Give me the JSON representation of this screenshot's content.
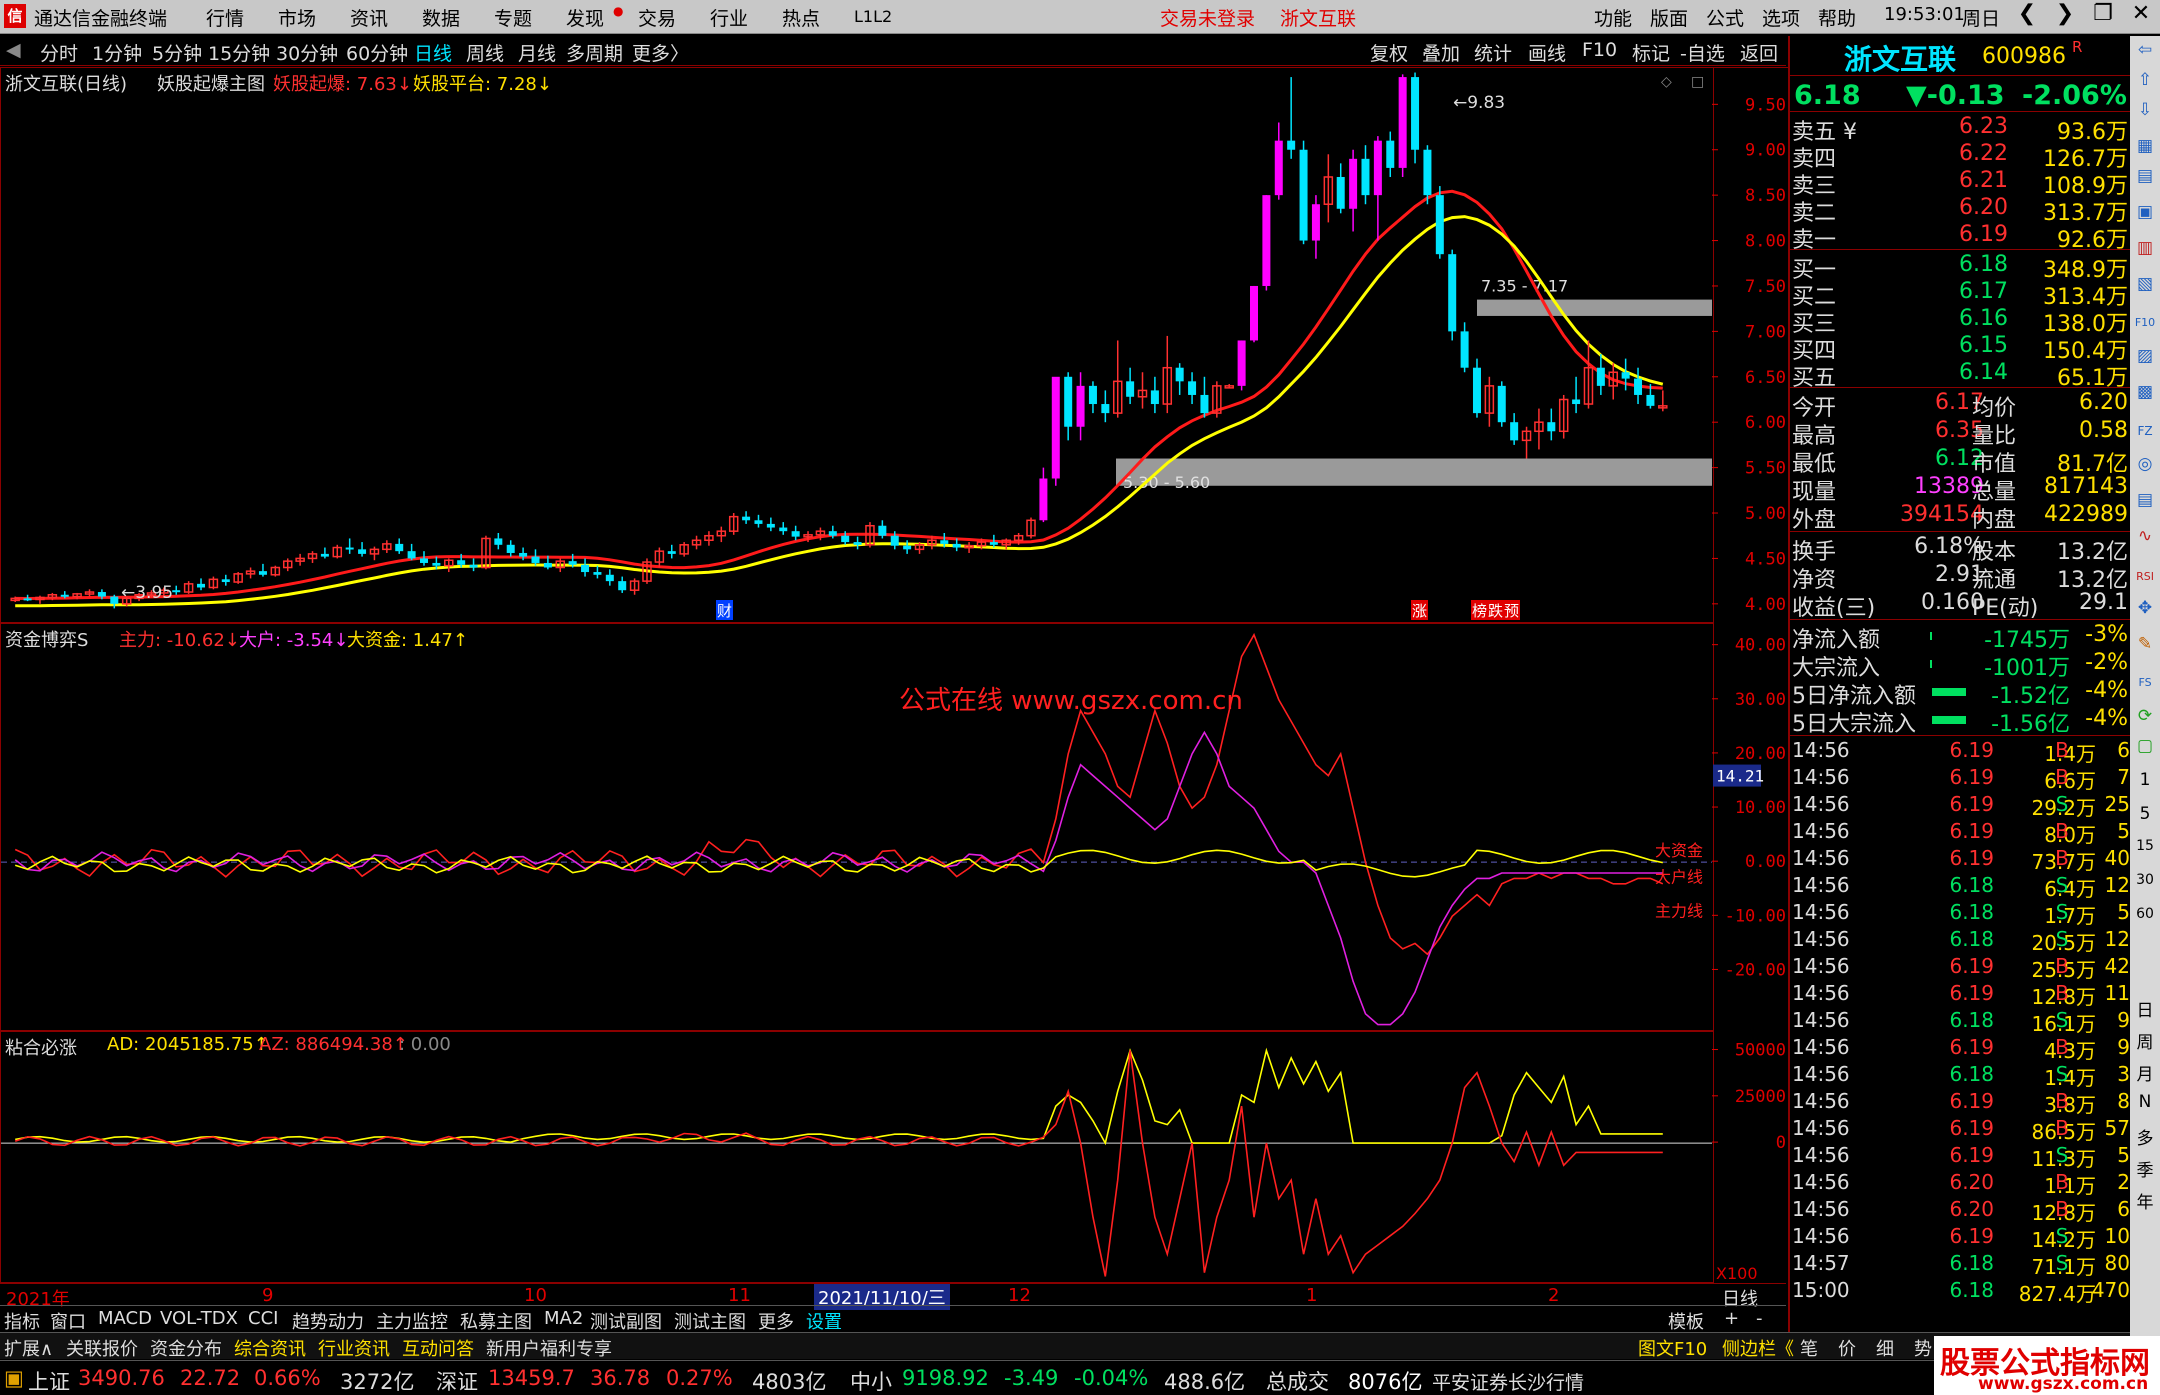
{
  "app": {
    "title": "通达信金融终端",
    "menus": [
      "行情",
      "市场",
      "资讯",
      "数据",
      "专题",
      "发现",
      "交易",
      "行业",
      "热点",
      "L1L2"
    ],
    "center_left": "交易未登录",
    "center_right": "浙文互联",
    "right_menus": [
      "功能",
      "版面",
      "公式",
      "选项",
      "帮助"
    ],
    "clock": "19:53:01",
    "weekday": "周日",
    "wctrl": [
      "❮",
      "❯",
      "❐",
      "✕"
    ]
  },
  "periods": [
    "分时",
    "1分钟",
    "5分钟",
    "15分钟",
    "30分钟",
    "60分钟",
    "日线",
    "周线",
    "月线",
    "多周期",
    "更多〉"
  ],
  "chart_tools": [
    "复权",
    "叠加",
    "统计",
    "画线",
    "F10",
    "标记",
    "-自选",
    "返回"
  ],
  "main_chart": {
    "header": {
      "name": "浙文互联(日线)",
      "formula": "妖股起爆主图",
      "i1": "妖股起爆: 7.63↓",
      "i2": "妖股平台: 7.28↓"
    },
    "yticks": [
      "9.50",
      "9.00",
      "8.50",
      "8.00",
      "7.50",
      "7.00",
      "6.50",
      "6.00",
      "5.50",
      "5.00",
      "4.50",
      "4.00"
    ],
    "ymin": 3.8,
    "ymax": 9.9,
    "annotations": {
      "high": "9.83",
      "low": "3.95",
      "band1": "5.30 - 5.60",
      "band2": "7.35 - 7.17"
    },
    "bands": [
      [
        5.3,
        5.6
      ],
      [
        7.17,
        7.35
      ]
    ],
    "markers": [
      "财",
      "涨",
      "榜",
      "跌",
      "预"
    ],
    "candles": [
      [
        4.05,
        4.08,
        4.02,
        4.06
      ],
      [
        4.06,
        4.1,
        4.03,
        4.05
      ],
      [
        4.05,
        4.09,
        4.0,
        4.07
      ],
      [
        4.07,
        4.12,
        4.04,
        4.1
      ],
      [
        4.1,
        4.14,
        4.06,
        4.08
      ],
      [
        4.08,
        4.12,
        4.05,
        4.11
      ],
      [
        4.11,
        4.16,
        4.08,
        4.13
      ],
      [
        4.13,
        4.16,
        4.05,
        4.08
      ],
      [
        4.08,
        4.1,
        3.95,
        4.0
      ],
      [
        4.0,
        4.08,
        3.97,
        4.06
      ],
      [
        4.06,
        4.12,
        4.03,
        4.1
      ],
      [
        4.1,
        4.15,
        4.07,
        4.12
      ],
      [
        4.12,
        4.18,
        4.09,
        4.15
      ],
      [
        4.15,
        4.2,
        4.1,
        4.13
      ],
      [
        4.13,
        4.25,
        4.11,
        4.22
      ],
      [
        4.22,
        4.28,
        4.15,
        4.18
      ],
      [
        4.18,
        4.3,
        4.16,
        4.27
      ],
      [
        4.27,
        4.32,
        4.2,
        4.24
      ],
      [
        4.24,
        4.35,
        4.22,
        4.33
      ],
      [
        4.33,
        4.4,
        4.28,
        4.36
      ],
      [
        4.36,
        4.44,
        4.3,
        4.32
      ],
      [
        4.32,
        4.42,
        4.3,
        4.4
      ],
      [
        4.4,
        4.5,
        4.36,
        4.47
      ],
      [
        4.47,
        4.55,
        4.42,
        4.5
      ],
      [
        4.5,
        4.58,
        4.45,
        4.55
      ],
      [
        4.55,
        4.62,
        4.5,
        4.52
      ],
      [
        4.52,
        4.65,
        4.5,
        4.62
      ],
      [
        4.62,
        4.72,
        4.55,
        4.6
      ],
      [
        4.6,
        4.68,
        4.52,
        4.55
      ],
      [
        4.55,
        4.63,
        4.48,
        4.6
      ],
      [
        4.6,
        4.7,
        4.56,
        4.66
      ],
      [
        4.66,
        4.72,
        4.55,
        4.58
      ],
      [
        4.58,
        4.66,
        4.48,
        4.5
      ],
      [
        4.5,
        4.58,
        4.42,
        4.45
      ],
      [
        4.45,
        4.52,
        4.38,
        4.42
      ],
      [
        4.42,
        4.5,
        4.35,
        4.48
      ],
      [
        4.48,
        4.55,
        4.4,
        4.43
      ],
      [
        4.43,
        4.5,
        4.36,
        4.4
      ],
      [
        4.4,
        4.75,
        4.38,
        4.72
      ],
      [
        4.72,
        4.78,
        4.6,
        4.65
      ],
      [
        4.65,
        4.7,
        4.52,
        4.56
      ],
      [
        4.56,
        4.62,
        4.48,
        4.52
      ],
      [
        4.52,
        4.6,
        4.42,
        4.45
      ],
      [
        4.45,
        4.53,
        4.38,
        4.4
      ],
      [
        4.4,
        4.5,
        4.35,
        4.47
      ],
      [
        4.47,
        4.55,
        4.4,
        4.43
      ],
      [
        4.43,
        4.5,
        4.3,
        4.35
      ],
      [
        4.35,
        4.42,
        4.28,
        4.32
      ],
      [
        4.32,
        4.38,
        4.2,
        4.25
      ],
      [
        4.25,
        4.3,
        4.12,
        4.15
      ],
      [
        4.15,
        4.28,
        4.1,
        4.25
      ],
      [
        4.25,
        4.5,
        4.22,
        4.46
      ],
      [
        4.46,
        4.62,
        4.4,
        4.58
      ],
      [
        4.58,
        4.65,
        4.5,
        4.55
      ],
      [
        4.55,
        4.68,
        4.52,
        4.65
      ],
      [
        4.65,
        4.75,
        4.6,
        4.7
      ],
      [
        4.7,
        4.8,
        4.64,
        4.75
      ],
      [
        4.75,
        4.85,
        4.68,
        4.8
      ],
      [
        4.8,
        5.0,
        4.76,
        4.96
      ],
      [
        4.96,
        5.02,
        4.88,
        4.92
      ],
      [
        4.92,
        4.98,
        4.84,
        4.88
      ],
      [
        4.88,
        4.95,
        4.8,
        4.84
      ],
      [
        4.84,
        4.9,
        4.76,
        4.8
      ],
      [
        4.8,
        4.86,
        4.7,
        4.74
      ],
      [
        4.74,
        4.8,
        4.68,
        4.76
      ],
      [
        4.76,
        4.84,
        4.7,
        4.8
      ],
      [
        4.8,
        4.86,
        4.72,
        4.75
      ],
      [
        4.75,
        4.8,
        4.65,
        4.68
      ],
      [
        4.68,
        4.74,
        4.6,
        4.65
      ],
      [
        4.65,
        4.9,
        4.62,
        4.86
      ],
      [
        4.86,
        4.92,
        4.72,
        4.75
      ],
      [
        4.75,
        4.8,
        4.6,
        4.64
      ],
      [
        4.64,
        4.7,
        4.55,
        4.6
      ],
      [
        4.6,
        4.68,
        4.55,
        4.65
      ],
      [
        4.65,
        4.75,
        4.6,
        4.7
      ],
      [
        4.7,
        4.78,
        4.62,
        4.66
      ],
      [
        4.66,
        4.72,
        4.58,
        4.62
      ],
      [
        4.62,
        4.68,
        4.56,
        4.64
      ],
      [
        4.64,
        4.72,
        4.6,
        4.68
      ],
      [
        4.68,
        4.76,
        4.62,
        4.65
      ],
      [
        4.65,
        4.72,
        4.6,
        4.7
      ],
      [
        4.7,
        4.78,
        4.65,
        4.75
      ],
      [
        4.75,
        4.95,
        4.72,
        4.92
      ],
      [
        4.92,
        5.5,
        4.9,
        5.38
      ],
      [
        5.38,
        6.4,
        5.3,
        6.5
      ],
      [
        6.5,
        6.55,
        5.8,
        5.95
      ],
      [
        5.95,
        6.55,
        5.8,
        6.4
      ],
      [
        6.4,
        6.45,
        6.1,
        6.2
      ],
      [
        6.2,
        6.35,
        6.0,
        6.1
      ],
      [
        6.1,
        6.9,
        6.05,
        6.45
      ],
      [
        6.45,
        6.6,
        6.2,
        6.28
      ],
      [
        6.28,
        6.55,
        6.15,
        6.35
      ],
      [
        6.35,
        6.5,
        6.1,
        6.2
      ],
      [
        6.2,
        6.95,
        6.1,
        6.6
      ],
      [
        6.6,
        6.65,
        6.3,
        6.45
      ],
      [
        6.45,
        6.55,
        6.2,
        6.3
      ],
      [
        6.3,
        6.5,
        6.05,
        6.1
      ],
      [
        6.1,
        6.45,
        6.05,
        6.4
      ],
      [
        6.4,
        6.42,
        6.38,
        6.4
      ],
      [
        6.4,
        6.9,
        6.35,
        6.9
      ],
      [
        6.9,
        7.5,
        6.88,
        7.5
      ],
      [
        7.5,
        8.5,
        7.45,
        8.5
      ],
      [
        8.5,
        9.3,
        8.45,
        9.1
      ],
      [
        9.1,
        9.8,
        8.9,
        9.0
      ],
      [
        9.0,
        9.1,
        7.96,
        8.0
      ],
      [
        8.0,
        8.5,
        7.8,
        8.4
      ],
      [
        8.4,
        8.95,
        8.2,
        8.7
      ],
      [
        8.7,
        8.85,
        8.3,
        8.35
      ],
      [
        8.35,
        9.0,
        8.1,
        8.9
      ],
      [
        8.9,
        9.05,
        8.4,
        8.5
      ],
      [
        8.5,
        9.15,
        8.0,
        9.1
      ],
      [
        9.1,
        9.2,
        8.7,
        8.8
      ],
      [
        8.8,
        9.83,
        8.7,
        9.8
      ],
      [
        9.8,
        9.85,
        8.85,
        9.0
      ],
      [
        9.0,
        9.05,
        8.4,
        8.5
      ],
      [
        8.5,
        8.6,
        7.8,
        7.85
      ],
      [
        7.85,
        7.9,
        6.9,
        7.0
      ],
      [
        7.0,
        7.1,
        6.55,
        6.6
      ],
      [
        6.6,
        6.7,
        6.05,
        6.1
      ],
      [
        6.1,
        6.5,
        5.95,
        6.4
      ],
      [
        6.4,
        6.45,
        5.95,
        6.0
      ],
      [
        6.0,
        6.1,
        5.75,
        5.8
      ],
      [
        5.8,
        5.95,
        5.6,
        5.9
      ],
      [
        5.9,
        6.15,
        5.7,
        6.0
      ],
      [
        6.0,
        6.15,
        5.8,
        5.9
      ],
      [
        5.9,
        6.3,
        5.82,
        6.25
      ],
      [
        6.25,
        6.5,
        6.1,
        6.2
      ],
      [
        6.2,
        6.9,
        6.15,
        6.6
      ],
      [
        6.6,
        6.75,
        6.3,
        6.4
      ],
      [
        6.4,
        6.65,
        6.25,
        6.55
      ],
      [
        6.55,
        6.7,
        6.35,
        6.48
      ],
      [
        6.48,
        6.6,
        6.2,
        6.3
      ],
      [
        6.3,
        6.42,
        6.15,
        6.18
      ],
      [
        6.18,
        6.35,
        6.12,
        6.18
      ]
    ]
  },
  "mid_chart": {
    "header": {
      "name": "资金博弈S",
      "a": "主力: -10.62↓",
      "b": "大户: -3.54↓",
      "c": "大资金: 1.47↑"
    },
    "watermark": "公式在线  www.gszx.com.cn",
    "yticks": [
      "40.00",
      "30.00",
      "20.00",
      "10.00",
      "0.00",
      "-10.00",
      "-20.00"
    ],
    "ymin": -31,
    "ymax": 44,
    "cursor_value": "14.21",
    "line_labels": [
      "大资金",
      "大户线",
      "主力线"
    ]
  },
  "low_chart": {
    "header": {
      "name": "粘合必涨",
      "a": "AD: 2045185.75↑",
      "b": "AZ: 886494.38↑",
      "c": ": 0.00"
    },
    "yticks": [
      "50000",
      "25000",
      "0"
    ],
    "ymin": -75000,
    "ymax": 60000,
    "scale_label": "X100"
  },
  "xaxis": [
    "2021年",
    "9",
    "10",
    "11",
    "12",
    "1",
    "2"
  ],
  "xaxis_sel": "2021/11/10/三",
  "xaxis_right": "日线",
  "quote": {
    "name": "浙文互联",
    "code": "600986",
    "flag": "R",
    "price": "6.18",
    "change": "▼-0.13",
    "pct": "-2.06%",
    "asks": [
      [
        "卖五 ¥",
        "6.23",
        "93.6万"
      ],
      [
        "卖四",
        "6.22",
        "126.7万"
      ],
      [
        "卖三",
        "6.21",
        "108.9万"
      ],
      [
        "卖二",
        "6.20",
        "313.7万"
      ],
      [
        "卖一",
        "6.19",
        "92.6万"
      ]
    ],
    "bids": [
      [
        "买一",
        "6.18",
        "348.9万"
      ],
      [
        "买二",
        "6.17",
        "313.4万"
      ],
      [
        "买三",
        "6.16",
        "138.0万"
      ],
      [
        "买四",
        "6.15",
        "150.4万"
      ],
      [
        "买五",
        "6.14",
        "65.1万"
      ]
    ],
    "stats": [
      [
        "今开",
        "6.17",
        "均价",
        "6.20"
      ],
      [
        "最高",
        "6.35",
        "量比",
        "0.58"
      ],
      [
        "最低",
        "6.12",
        "市值",
        "81.7亿"
      ],
      [
        "现量",
        "13389",
        "总量",
        "817143"
      ],
      [
        "外盘",
        "394154",
        "内盘",
        "422989"
      ]
    ],
    "fund": [
      [
        "换手",
        "6.18%",
        "股本",
        "13.2亿"
      ],
      [
        "净资",
        "2.91",
        "流通",
        "13.2亿"
      ],
      [
        "收益(三)",
        "0.160",
        "PE(动)",
        "29.1"
      ]
    ],
    "flows": [
      [
        "净流入额",
        "-1745万",
        "-3%"
      ],
      [
        "大宗流入",
        "-1001万",
        "-2%"
      ],
      [
        "5日净流入额",
        "-1.52亿",
        "-4%"
      ],
      [
        "5日大宗流入",
        "-1.56亿",
        "-4%"
      ]
    ],
    "ticks": [
      [
        "14:56",
        "6.19",
        "1.4万",
        "B",
        "6"
      ],
      [
        "14:56",
        "6.19",
        "6.6万",
        "B",
        "7"
      ],
      [
        "14:56",
        "6.19",
        "29.2万",
        "S",
        "25"
      ],
      [
        "14:56",
        "6.19",
        "8.0万",
        "B",
        "5"
      ],
      [
        "14:56",
        "6.19",
        "73.7万",
        "B",
        "40"
      ],
      [
        "14:56",
        "6.18",
        "6.4万",
        "S",
        "12"
      ],
      [
        "14:56",
        "6.18",
        "1.7万",
        "S",
        "5"
      ],
      [
        "14:56",
        "6.18",
        "20.5万",
        "S",
        "12"
      ],
      [
        "14:56",
        "6.19",
        "25.5万",
        "B",
        "42"
      ],
      [
        "14:56",
        "6.19",
        "12.8万",
        "B",
        "11"
      ],
      [
        "14:56",
        "6.18",
        "16.1万",
        "S",
        "9"
      ],
      [
        "14:56",
        "6.19",
        "4.3万",
        "B",
        "9"
      ],
      [
        "14:56",
        "6.18",
        "1.4万",
        "S",
        "3"
      ],
      [
        "14:56",
        "6.19",
        "3.8万",
        "B",
        "8"
      ],
      [
        "14:56",
        "6.19",
        "86.5万",
        "B",
        "57"
      ],
      [
        "14:56",
        "6.19",
        "11.3万",
        "S",
        "5"
      ],
      [
        "14:56",
        "6.20",
        "1.1万",
        "B",
        "2"
      ],
      [
        "14:56",
        "6.20",
        "12.8万",
        "B",
        "6"
      ],
      [
        "14:56",
        "6.19",
        "14.2万",
        "S",
        "10"
      ],
      [
        "14:57",
        "6.18",
        "71.1万",
        "S",
        "80"
      ],
      [
        "15:00",
        "6.18",
        "827.4万",
        "",
        "470"
      ]
    ]
  },
  "sidebar": [
    "日",
    "周",
    "月",
    "N",
    "多",
    "季",
    "年",
    "1",
    "5",
    "15",
    "30",
    "60"
  ],
  "tabs1": [
    "指标",
    "窗口",
    "MACD",
    "VOL-TDX",
    "CCI",
    "趋势动力",
    "主力监控",
    "私募主图",
    "MA2",
    "测试副图",
    "测试主图",
    "更多",
    "设置"
  ],
  "tabs1_right": [
    "模板",
    "+",
    "-"
  ],
  "tabs2": [
    "扩展∧",
    "关联报价",
    "资金分布",
    "综合资讯",
    "行业资讯",
    "互动问答",
    "新用户福利专享"
  ],
  "tabs2_right": [
    "图文F10",
    "侧边栏《",
    "笔",
    "价",
    "细",
    "势"
  ],
  "status": {
    "sh": "上证",
    "sh_v": "3490.76",
    "sh_c": "22.72",
    "sh_p": "0.66%",
    "sh_a": "3272亿",
    "sz": "深证",
    "sz_v": "13459.7",
    "sz_c": "36.78",
    "sz_p": "0.27%",
    "sz_a": "4803亿",
    "zx": "中小",
    "zx_v": "9198.92",
    "zx_c": "-3.49",
    "zx_p": "-0.04%",
    "zx_a": "488.6亿",
    "tot": "总成交",
    "tot_v": "8076亿",
    "broker": "平安证券长沙行情"
  },
  "brand": {
    "line1": "股票公式指标网",
    "line2": "www.gszx.com.cn"
  },
  "colors": {
    "up": "#ff3030",
    "down": "#00e5ff",
    "limit": "#ff00ff",
    "red_line": "#ff1a1a",
    "yellow_line": "#ffff00",
    "magenta_line": "#e020e0"
  }
}
